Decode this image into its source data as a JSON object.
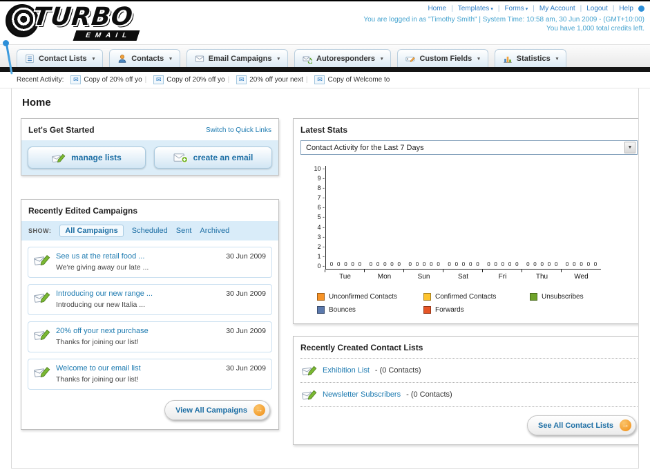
{
  "header": {
    "logo_title": "TURBO",
    "logo_subtitle": "EMAIL",
    "links": [
      {
        "label": "Home",
        "dropdown": false
      },
      {
        "label": "Templates",
        "dropdown": true
      },
      {
        "label": "Forms",
        "dropdown": true
      },
      {
        "label": "My Account",
        "dropdown": false
      },
      {
        "label": "Logout",
        "dropdown": false
      },
      {
        "label": "Help",
        "dropdown": false
      }
    ],
    "session_line": "You are logged in as \"Timothy Smith\" | System Time: 10:58 am, 30 Jun 2009 - (GMT+10:00)",
    "credits_line": "You have 1,000 total credits left."
  },
  "nav": {
    "items": [
      {
        "label": "Contact Lists",
        "icon": "list-icon"
      },
      {
        "label": "Contacts",
        "icon": "person-icon"
      },
      {
        "label": "Email Campaigns",
        "icon": "mail-icon"
      },
      {
        "label": "Autoresponders",
        "icon": "autoresponder-icon"
      },
      {
        "label": "Custom Fields",
        "icon": "field-icon"
      },
      {
        "label": "Statistics",
        "icon": "chart-icon"
      }
    ]
  },
  "recent_activity": {
    "label": "Recent Activity:",
    "items": [
      {
        "text": "Copy of 20% off yo"
      },
      {
        "text": "Copy of 20% off yo"
      },
      {
        "text": "20% off your next"
      },
      {
        "text": "Copy of Welcome to"
      }
    ]
  },
  "page": {
    "title": "Home"
  },
  "get_started": {
    "title": "Let's Get Started",
    "switch_link": "Switch to Quick Links",
    "manage_lists_label": "manage lists",
    "create_email_label": "create an email"
  },
  "campaigns": {
    "title": "Recently Edited Campaigns",
    "show_label": "SHOW:",
    "tabs": [
      {
        "label": "All Campaigns",
        "active": true
      },
      {
        "label": "Scheduled",
        "active": false
      },
      {
        "label": "Sent",
        "active": false
      },
      {
        "label": "Archived",
        "active": false
      }
    ],
    "items": [
      {
        "title": "See us at the retail food ...",
        "subtitle": "We're giving away our late ...",
        "date": "30 Jun 2009"
      },
      {
        "title": "Introducing our new range ...",
        "subtitle": "Introducing our new Italia ...",
        "date": "30 Jun 2009"
      },
      {
        "title": "20% off your next purchase",
        "subtitle": "Thanks for joining our list!",
        "date": "30 Jun 2009"
      },
      {
        "title": "Welcome to our email list",
        "subtitle": "Thanks for joining our list!",
        "date": "30 Jun 2009"
      }
    ],
    "view_all_label": "View All Campaigns"
  },
  "stats": {
    "title": "Latest Stats",
    "selected_option": "Contact Activity for the Last 7 Days",
    "chart_data": {
      "type": "bar",
      "title": "Contact Activity for the Last 7 Days",
      "categories": [
        "Tue",
        "Mon",
        "Sun",
        "Sat",
        "Fri",
        "Thu",
        "Wed"
      ],
      "series": [
        {
          "name": "Unconfirmed Contacts",
          "color": "#f79326",
          "values": [
            0,
            0,
            0,
            0,
            0,
            0,
            0
          ]
        },
        {
          "name": "Confirmed Contacts",
          "color": "#fdc32e",
          "values": [
            0,
            0,
            0,
            0,
            0,
            0,
            0
          ]
        },
        {
          "name": "Unsubscribes",
          "color": "#6fa32a",
          "values": [
            0,
            0,
            0,
            0,
            0,
            0,
            0
          ]
        },
        {
          "name": "Bounces",
          "color": "#5b79ad",
          "values": [
            0,
            0,
            0,
            0,
            0,
            0,
            0
          ]
        },
        {
          "name": "Forwards",
          "color": "#e65526",
          "values": [
            0,
            0,
            0,
            0,
            0,
            0,
            0
          ]
        }
      ],
      "ylim": [
        0,
        10
      ],
      "grid": false,
      "legend_position": "bottom"
    }
  },
  "contact_lists": {
    "title": "Recently Created Contact Lists",
    "items": [
      {
        "name": "Exhibition List",
        "suffix": "- (0 Contacts)"
      },
      {
        "name": "Newsletter Subscribers",
        "suffix": "- (0 Contacts)"
      }
    ],
    "see_all_label": "See All Contact Lists"
  }
}
